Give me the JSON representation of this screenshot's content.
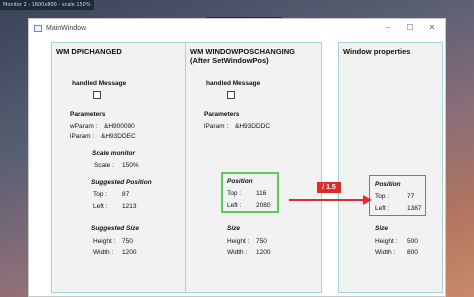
{
  "monitor_label": "Monitor 2 : 1600x800 - scale 150%",
  "window": {
    "title": "MainWindow",
    "controls": [
      "–",
      "☐",
      "✕"
    ]
  },
  "toolbar": {
    "icons": [
      "select-tool-icon",
      "pointer-icon",
      "screen-icon",
      "cursor-icon",
      "target-icon",
      "check-circle-icon"
    ]
  },
  "panel_dpi": {
    "title": "WM DPICHANGED",
    "handled_label": "handled Message",
    "parameters_label": "Parameters",
    "wparam_label": "wParam :",
    "wparam_value": "&H900090",
    "lparam_label": "lParam :",
    "lparam_value": "&H93DDEC",
    "scale_label": "Scale monitor",
    "scale_name": "Scale :",
    "scale_value": "150%",
    "sugg_pos_label": "Suggested Position",
    "top_label": "Top :",
    "top_value": "87",
    "left_label": "Left :",
    "left_value": "1213",
    "sugg_size_label": "Suggested Size",
    "height_label": "Height :",
    "height_value": "750",
    "width_label": "Width :",
    "width_value": "1200"
  },
  "panel_pos": {
    "title_line1": "WM WINDOWPOSCHANGING",
    "title_line2": "(After SetWindowPos)",
    "handled_label": "handled Message",
    "parameters_label": "Parameters",
    "lparam_label": "lParam :",
    "lparam_value": "&H93DDDC",
    "position_label": "Position",
    "top_label": "Top :",
    "top_value": "116",
    "left_label": "Left :",
    "left_value": "2080",
    "size_label": "Size",
    "height_label": "Height :",
    "height_value": "750",
    "width_label": "Width :",
    "width_value": "1200"
  },
  "panel_props": {
    "title": "Window properties",
    "position_label": "Position",
    "top_label": "Top :",
    "top_value": "77",
    "left_label": "Left :",
    "left_value": "1387",
    "size_label": "Size",
    "height_label": "Height :",
    "height_value": "500",
    "width_label": "Width :",
    "width_value": "800"
  },
  "annotation": {
    "ratio_text": "/ 1.5",
    "highlight_green": "#5bc95b",
    "highlight_red": "#dd2c2c"
  }
}
